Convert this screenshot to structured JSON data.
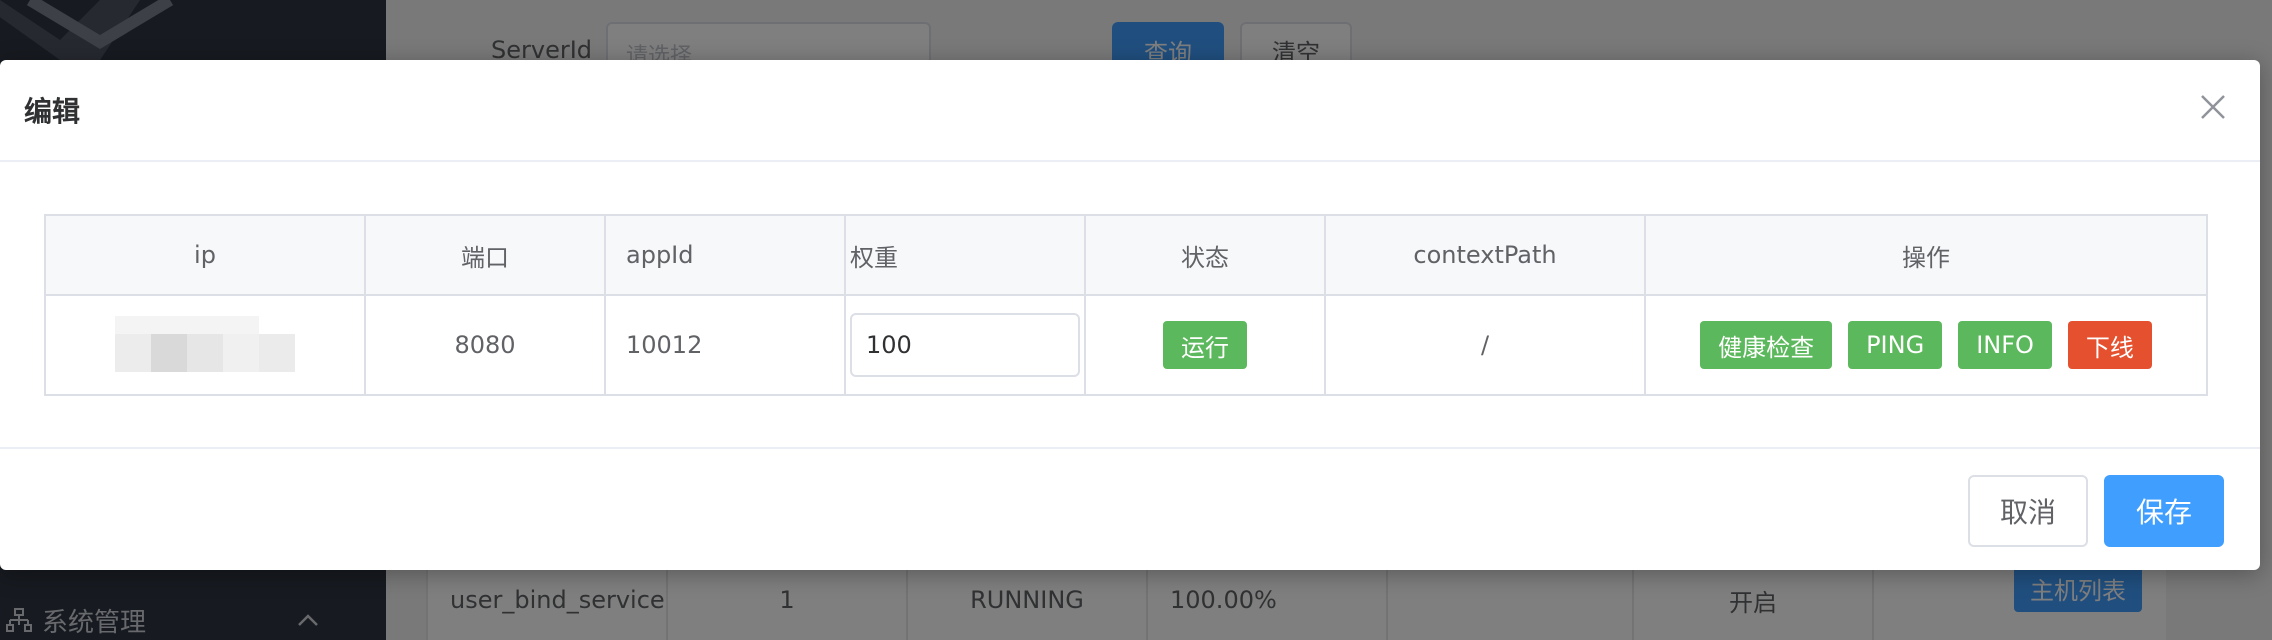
{
  "background": {
    "sidebar": {
      "menu_label": "系统管理"
    },
    "filter": {
      "label": "ServerId",
      "placeholder": "请选择",
      "query_label": "查询",
      "clear_label": "清空"
    },
    "row": {
      "name": "user_bind_service",
      "count": "1",
      "status": "RUNNING",
      "percent": "100.00%",
      "enabled": "开启",
      "action": "主机列表"
    }
  },
  "dialog": {
    "title": "编辑",
    "table": {
      "headers": [
        "ip",
        "端口",
        "appId",
        "权重",
        "状态",
        "contextPath",
        "操作"
      ],
      "row": {
        "port": "8080",
        "appId": "10012",
        "weight": "100",
        "status": "运行",
        "contextPath": "/",
        "actions": [
          "健康检查",
          "PING",
          "INFO",
          "下线"
        ]
      }
    },
    "footer": {
      "cancel_label": "取消",
      "save_label": "保存"
    }
  },
  "colors": {
    "primary": "#409eff",
    "success": "#5cb85c",
    "danger": "#e5512f"
  }
}
